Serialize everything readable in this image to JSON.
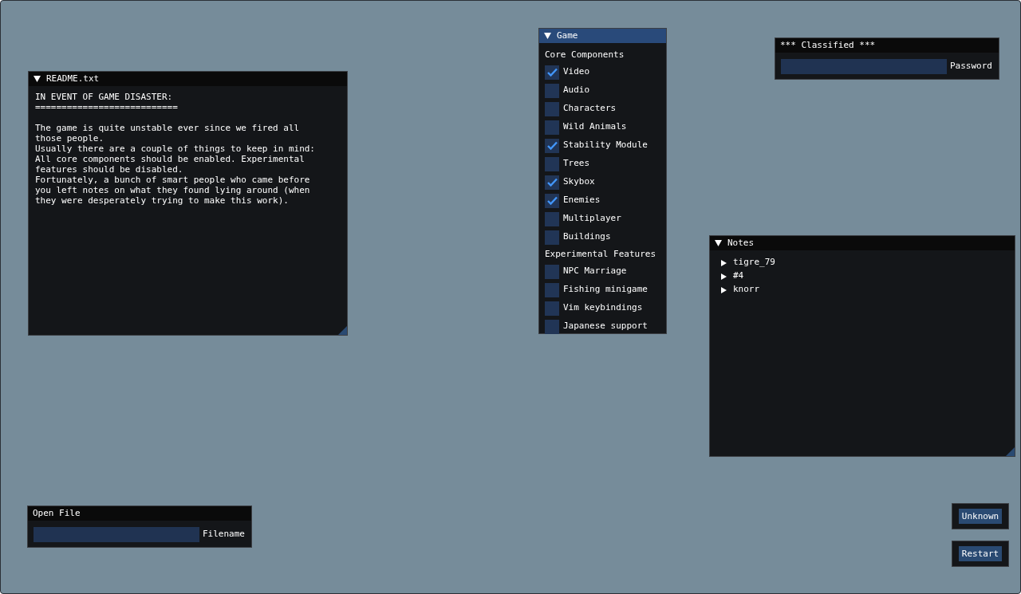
{
  "windows": [
    {
      "kind": "text",
      "title": "README.txt",
      "expanded": true,
      "focused": false,
      "paragraphs": [
        [
          "IN EVENT OF GAME DISASTER:",
          "==========================="
        ],
        [
          "The game is quite unstable ever since we fired all",
          "those people.",
          "Usually there are a couple of things to keep in mind:",
          "All core components should be enabled. Experimental",
          "features should be disabled.",
          "Fortunately, a bunch of smart people who came before",
          "you left notes on what they found lying around (when",
          "they were desperately trying to make this work)."
        ]
      ]
    },
    {
      "kind": "checklist",
      "title": "Game",
      "expanded": true,
      "focused": true,
      "groups": [
        {
          "heading": "Core Components",
          "items": [
            {
              "label": "Video",
              "checked": true
            },
            {
              "label": "Audio",
              "checked": false
            },
            {
              "label": "Characters",
              "checked": false
            },
            {
              "label": "Wild Animals",
              "checked": false
            },
            {
              "label": "Stability Module",
              "checked": true
            },
            {
              "label": "Trees",
              "checked": false
            },
            {
              "label": "Skybox",
              "checked": true
            },
            {
              "label": "Enemies",
              "checked": true
            },
            {
              "label": "Multiplayer",
              "checked": false
            },
            {
              "label": "Buildings",
              "checked": false
            }
          ]
        },
        {
          "heading": "Experimental Features",
          "items": [
            {
              "label": "NPC Marriage",
              "checked": false
            },
            {
              "label": "Fishing minigame",
              "checked": false
            },
            {
              "label": "Vim keybindings",
              "checked": false
            },
            {
              "label": "Japanese support",
              "checked": false
            }
          ]
        }
      ]
    },
    {
      "kind": "input",
      "title": "*** Classified ***",
      "focused": false,
      "label": "Password"
    },
    {
      "kind": "tree",
      "title": "Notes",
      "expanded": true,
      "focused": false,
      "items": [
        {
          "label": "tigre_79",
          "expanded": false
        },
        {
          "label": "#4",
          "expanded": false
        },
        {
          "label": "knorr",
          "expanded": false
        }
      ]
    },
    {
      "kind": "input",
      "title": "Open File",
      "focused": false,
      "label": "Filename"
    },
    {
      "kind": "button",
      "label": "Unknown"
    },
    {
      "kind": "button",
      "label": "Restart"
    }
  ]
}
